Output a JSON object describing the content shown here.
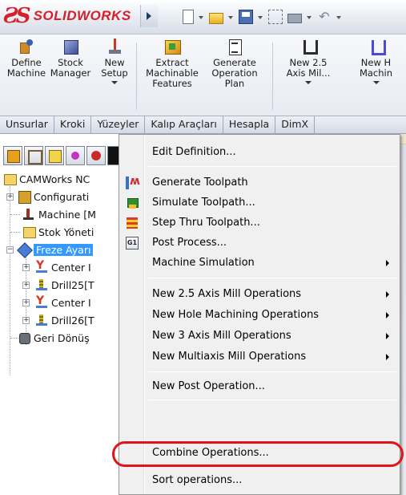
{
  "app": {
    "logo_mark": "ƧS",
    "logo_text": "SOLIDWORKS"
  },
  "colors": {
    "brand_red": "#d4202a",
    "selection_blue": "#3399ff",
    "highlight_ring": "#e1141c"
  },
  "toolbar": {
    "commands": [
      {
        "label": "Define\nMachine",
        "icon": "define-machine-icon"
      },
      {
        "label": "Stock\nManager",
        "icon": "stock-manager-icon"
      },
      {
        "label": "New\nSetup",
        "icon": "new-setup-icon"
      },
      {
        "label": "Extract\nMachinable\nFeatures",
        "icon": "extract-features-icon"
      },
      {
        "label": "Generate\nOperation\nPlan",
        "icon": "generate-plan-icon"
      },
      {
        "label": "New 2.5\nAxis Mil...",
        "icon": "new-25-axis-icon"
      },
      {
        "label": "New H\nMachin",
        "icon": "new-hole-machining-icon"
      }
    ]
  },
  "tabs": [
    "Unsurlar",
    "Kroki",
    "Yüzeyler",
    "Kalıp Araçları",
    "Hesapla",
    "DimX"
  ],
  "tree": {
    "root": "CAMWorks NC",
    "items": [
      {
        "label": "Configurati",
        "icon": "configuration-icon"
      },
      {
        "label": "Machine [M",
        "icon": "machine-icon"
      },
      {
        "label": "Stok Yöneti",
        "icon": "stock-icon"
      },
      {
        "label": "Freze Ayarı",
        "icon": "mill-setup-icon",
        "selected": true
      },
      {
        "label": "Center I",
        "icon": "center-drill-icon"
      },
      {
        "label": "Drill25[T",
        "icon": "drill-icon"
      },
      {
        "label": "Center I",
        "icon": "center-drill-icon"
      },
      {
        "label": "Drill26[T",
        "icon": "drill-icon"
      },
      {
        "label": "Geri Dönüş",
        "icon": "recycle-bin-icon"
      }
    ]
  },
  "context_menu": {
    "items": [
      {
        "label": "Edit Definition...",
        "submenu": false
      },
      {
        "label": "Generate Toolpath",
        "submenu": false,
        "icon": "generate-toolpath-icon"
      },
      {
        "label": "Simulate Toolpath...",
        "submenu": false,
        "icon": "simulate-toolpath-icon"
      },
      {
        "label": "Step Thru Toolpath...",
        "submenu": false,
        "icon": "step-thru-icon"
      },
      {
        "label": "Post Process...",
        "submenu": false,
        "icon": "post-process-icon",
        "icon_text": "G1"
      },
      {
        "label": "Machine Simulation",
        "submenu": true
      },
      {
        "label": "New 2.5 Axis Mill Operations",
        "submenu": true
      },
      {
        "label": "New Hole Machining Operations",
        "submenu": true
      },
      {
        "label": "New 3 Axis Mill Operations",
        "submenu": true
      },
      {
        "label": "New Multiaxis Mill Operations",
        "submenu": true
      },
      {
        "label": "New Post Operation...",
        "submenu": false
      },
      {
        "label": "Combine Operations...",
        "submenu": false,
        "highlighted": true
      },
      {
        "label": "Sort operations...",
        "submenu": false
      }
    ]
  }
}
